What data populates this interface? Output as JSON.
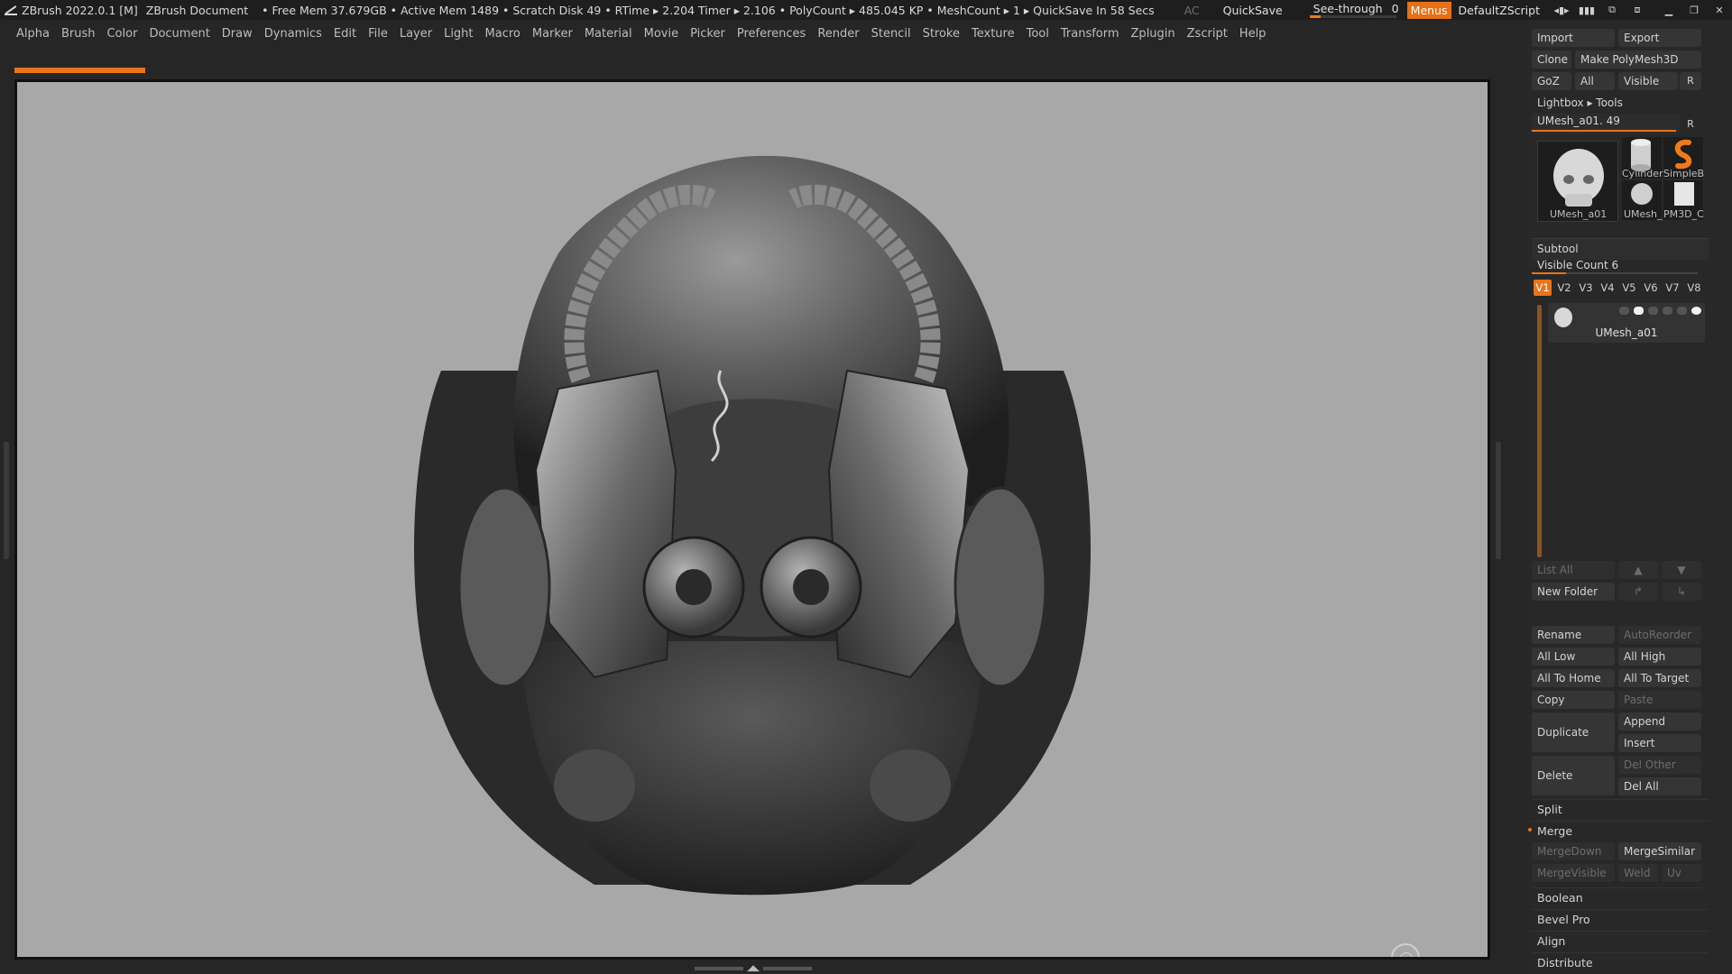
{
  "titlebar": {
    "app_title": "ZBrush 2022.0.1 [M]",
    "document": "ZBrush Document",
    "stats": "• Free Mem 37.679GB • Active Mem 1489 • Scratch Disk 49 •  RTime ▸ 2.204 Timer ▸ 2.106 • PolyCount ▸ 485.045 KP  • MeshCount ▸ 1  ▸ QuickSave In 58 Secs",
    "ac": "AC",
    "quicksave": "QuickSave",
    "seethrough_label": "See-through",
    "seethrough_value": "0",
    "menus": "Menus",
    "script": "DefaultZScript",
    "icons": [
      "layout-toggle-icon",
      "interface-config-icon",
      "window-arrange-icon",
      "window-split-icon",
      "minimize-icon",
      "restore-icon",
      "close-icon"
    ]
  },
  "menubar": {
    "items": [
      "Alpha",
      "Brush",
      "Color",
      "Document",
      "Draw",
      "Dynamics",
      "Edit",
      "File",
      "Layer",
      "Light",
      "Macro",
      "Marker",
      "Material",
      "Movie",
      "Picker",
      "Preferences",
      "Render",
      "Stencil",
      "Stroke",
      "Texture",
      "Tool",
      "Transform",
      "Zplugin",
      "Zscript",
      "Help"
    ]
  },
  "canvas": {
    "background": "#a8a8a8",
    "accent": "#e8731b"
  },
  "tool_panel": {
    "import": "Import",
    "export": "Export",
    "clone": "Clone",
    "make_polymesh": "Make PolyMesh3D",
    "goz": "GoZ",
    "all": "All",
    "visible": "Visible",
    "r": "R",
    "lightbox_tools": "Lightbox ▸ Tools",
    "current_tool_slider": "UMesh_a01. 49",
    "main_tool_caption": "UMesh_a01",
    "thumbs": [
      "Cylinder",
      "SimpleB",
      "UMesh_",
      "PM3D_C"
    ]
  },
  "subtool": {
    "title": "Subtool",
    "visible_count": "Visible Count 6",
    "visible_count_fraction": 0.2,
    "versions": [
      "V1",
      "V2",
      "V3",
      "V4",
      "V5",
      "V6",
      "V7",
      "V8"
    ],
    "active_version": "V1",
    "item_name": "UMesh_a01",
    "list_all": "List All",
    "new_folder": "New Folder",
    "rename": "Rename",
    "autoreorder": "AutoReorder",
    "all_low": "All Low",
    "all_high": "All High",
    "all_to_home": "All To Home",
    "all_to_target": "All To Target",
    "copy": "Copy",
    "paste": "Paste",
    "duplicate": "Duplicate",
    "append": "Append",
    "insert": "Insert",
    "delete": "Delete",
    "del_other": "Del Other",
    "del_all": "Del All",
    "split": "Split",
    "merge": "Merge",
    "mergedown": "MergeDown",
    "mergesimilar": "MergeSimilar",
    "mergevisible": "MergeVisible",
    "weld": "Weld",
    "uv": "Uv",
    "boolean": "Boolean",
    "bevel_pro": "Bevel Pro",
    "align": "Align",
    "distribute": "Distribute"
  }
}
